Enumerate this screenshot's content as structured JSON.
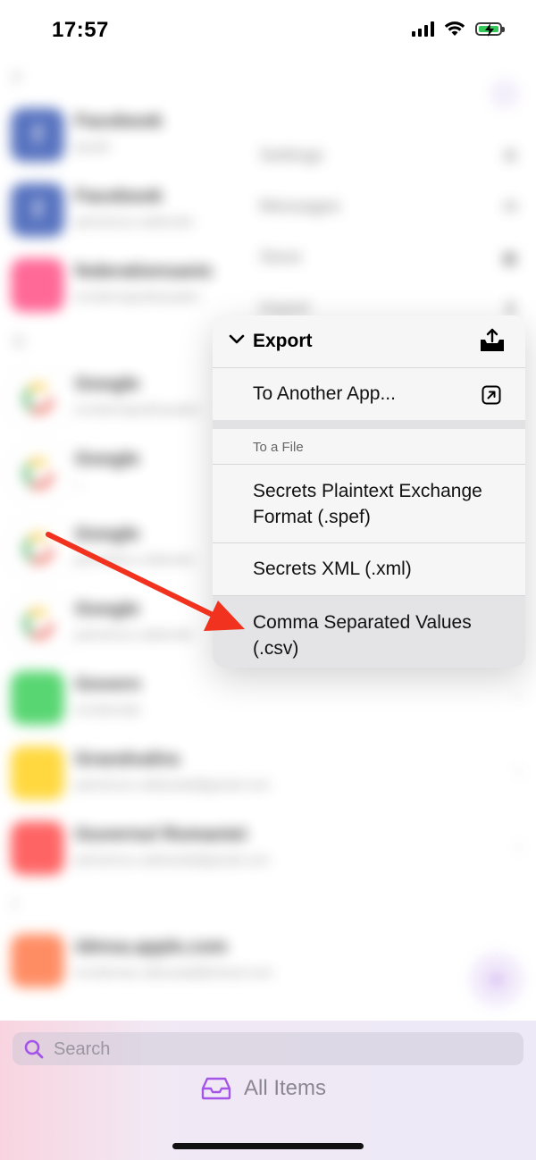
{
  "status_bar": {
    "time": "17:57"
  },
  "background_list": {
    "letters": [
      "F",
      "G",
      "G",
      "I"
    ],
    "rows": [
      {
        "title": "Facebook",
        "subtitle": "ţaxaiir",
        "icon": "facebook-icon",
        "color": "#3b5bb5"
      },
      {
        "title": "Facebook",
        "subtitle": "petrulrusu.valetrulet",
        "icon": "facebook-icon",
        "color": "#3b5bb5"
      },
      {
        "title": "federationsanic",
        "subtitle": "evrslenrapralnaualen",
        "icon": "app-icon",
        "color": "#ff4f86"
      },
      {
        "title": "Google",
        "subtitle": "evrslenrapralnaualen",
        "icon": "google-icon",
        "color": "#ffffff"
      },
      {
        "title": "Google",
        "subtitle": "–",
        "icon": "google-icon",
        "color": "#ffffff"
      },
      {
        "title": "Google",
        "subtitle": "pernnkreu.voltewsle",
        "icon": "google-icon",
        "color": "#ffffff"
      },
      {
        "title": "Google",
        "subtitle": "petrulrusu.valetrulet",
        "icon": "google-icon",
        "color": "#ffffff"
      },
      {
        "title": "Govern",
        "subtitle": "evrslenrale",
        "icon": "app-icon",
        "color": "#3ccf5a"
      },
      {
        "title": "Grandvalira",
        "subtitle": "petrulrusu.valetsulat@gmail.com",
        "icon": "app-icon",
        "color": "#ffd21f"
      },
      {
        "title": "Guvernul Romaniei",
        "subtitle": "petrulrusu.valetsulat@gmail.com",
        "icon": "app-icon",
        "color": "#ff4a4a"
      },
      {
        "title": "idmsa.apple.com",
        "subtitle": "evrslenrau.ralssuaal@icloud.com",
        "icon": "apple-icon",
        "color": "#ff7a4a"
      }
    ],
    "menu_items": [
      "Settings",
      "Messages",
      "Store",
      "Import"
    ]
  },
  "menu": {
    "header_title": "Export",
    "items": [
      {
        "label": "To Another App...",
        "icon": "arrow-up-right-box-icon"
      }
    ],
    "section_title": "To a File",
    "file_items": [
      {
        "label_line1": "Secrets Plaintext Exchange",
        "label_line2": "Format (.spef)"
      },
      {
        "label_line1": "Secrets XML (.xml)",
        "label_line2": ""
      },
      {
        "label_line1": "Comma Separated Values",
        "label_line2": "(.csv)"
      }
    ]
  },
  "bottom_bar": {
    "search_placeholder": "Search",
    "all_items_label": "All Items"
  },
  "colors": {
    "accent": "#a455e8",
    "annotation_red": "#f0321e",
    "menu_bg": "#f6f6f7",
    "selected_bg": "#e4e4e6"
  }
}
